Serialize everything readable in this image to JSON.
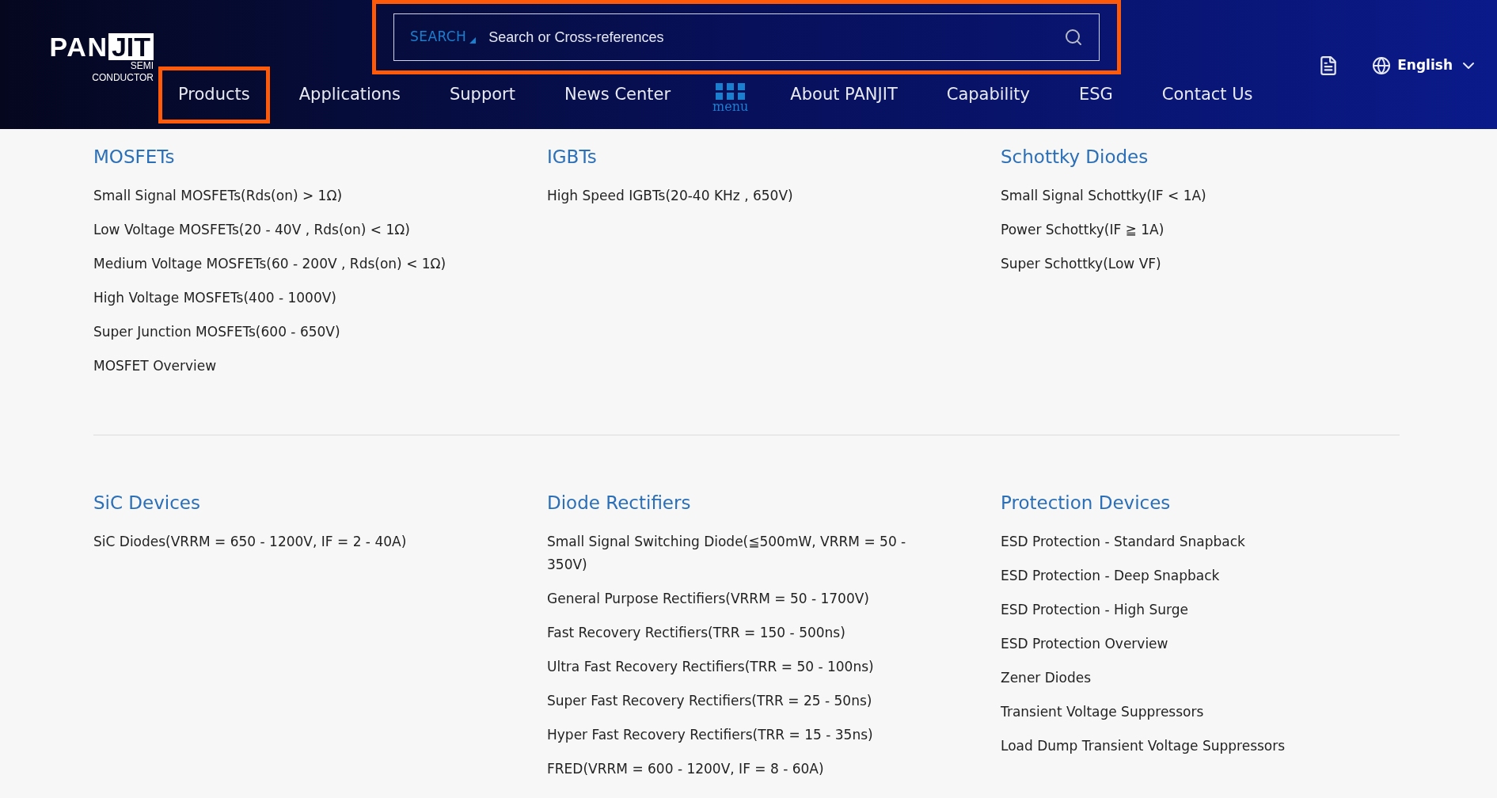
{
  "header": {
    "logo": {
      "left": "PAN",
      "right": "JIT",
      "tagline": [
        "SEMI",
        "CONDUCTOR"
      ]
    },
    "search": {
      "scope": "SEARCH",
      "placeholder": "Search or Cross-references",
      "highlighted": true
    },
    "nav": [
      {
        "label": "Products",
        "selected": true
      },
      {
        "label": "Applications",
        "selected": false
      },
      {
        "label": "Support",
        "selected": false
      },
      {
        "label": "News Center",
        "selected": false
      },
      {
        "label": "menu",
        "kind": "menu",
        "selected": false
      },
      {
        "label": "About PANJIT",
        "selected": false
      },
      {
        "label": "Capability",
        "selected": false
      },
      {
        "label": "ESG",
        "selected": false
      },
      {
        "label": "Contact Us",
        "selected": false
      }
    ],
    "language": "English"
  },
  "sections": [
    [
      {
        "title": "MOSFETs",
        "items": [
          "Small Signal MOSFETs(Rds(on) > 1Ω)",
          "Low Voltage MOSFETs(20 - 40V , Rds(on) < 1Ω)",
          "Medium Voltage MOSFETs(60 - 200V , Rds(on) < 1Ω)",
          "High Voltage MOSFETs(400 - 1000V)",
          "Super Junction MOSFETs(600 - 650V)",
          "MOSFET Overview"
        ]
      },
      {
        "title": "IGBTs",
        "items": [
          "High Speed IGBTs(20-40 KHz , 650V)"
        ]
      },
      {
        "title": "Schottky Diodes",
        "items": [
          "Small Signal Schottky(IF < 1A)",
          "Power Schottky(IF ≧ 1A)",
          "Super Schottky(Low VF)"
        ]
      }
    ],
    [
      {
        "title": "SiC Devices",
        "items": [
          "SiC Diodes(VRRM = 650 - 1200V, IF = 2 - 40A)"
        ]
      },
      {
        "title": "Diode Rectifiers",
        "items": [
          "Small Signal Switching Diode(≦500mW, VRRM = 50 - 350V)",
          "General Purpose Rectifiers(VRRM = 50 - 1700V)",
          "Fast Recovery Rectifiers(TRR = 150 - 500ns)",
          "Ultra Fast Recovery Rectifiers(TRR = 50 - 100ns)",
          "Super Fast Recovery Rectifiers(TRR = 25 - 50ns)",
          "Hyper Fast Recovery Rectifiers(TRR = 15 - 35ns)",
          "FRED(VRRM = 600 - 1200V, IF = 8 - 60A)"
        ]
      },
      {
        "title": "Protection Devices",
        "items": [
          "ESD Protection - Standard Snapback",
          "ESD Protection - Deep Snapback",
          "ESD Protection - High Surge",
          "ESD Protection Overview",
          "Zener Diodes",
          "Transient Voltage Suppressors",
          "Load Dump Transient Voltage Suppressors"
        ]
      }
    ]
  ]
}
